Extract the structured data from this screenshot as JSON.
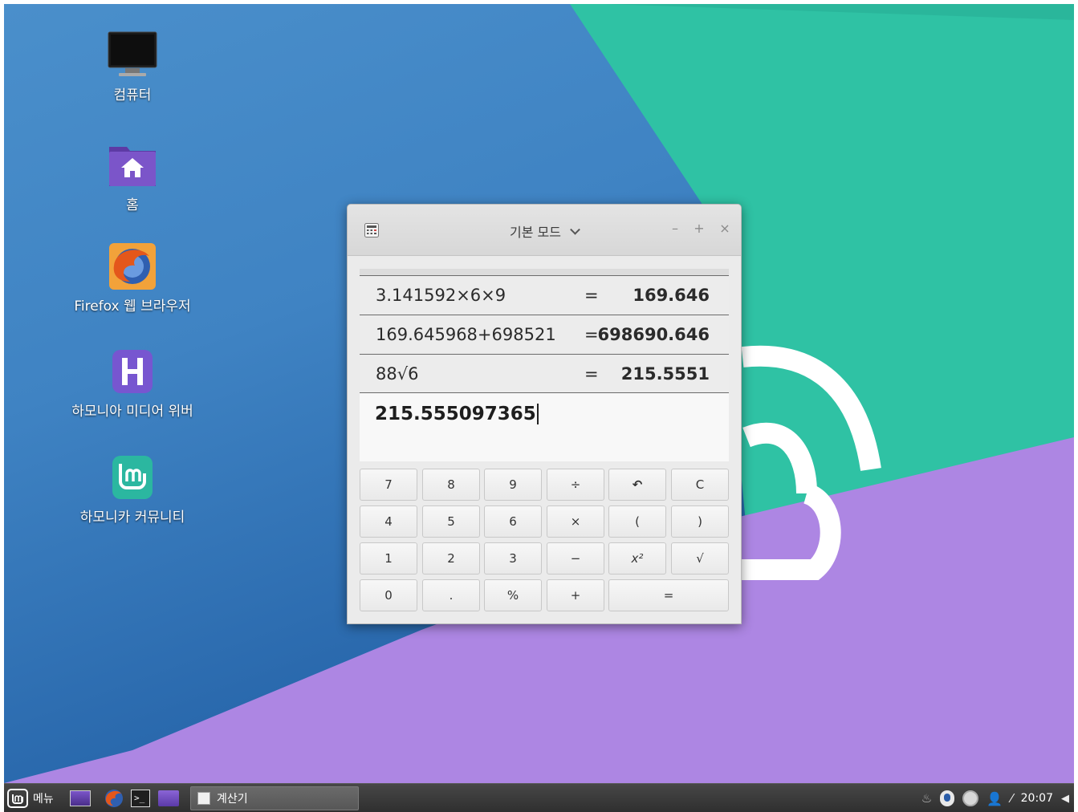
{
  "desktop": {
    "icons": [
      {
        "label": "컴퓨터",
        "icon": "computer-icon"
      },
      {
        "label": "홈",
        "icon": "home-folder-icon"
      },
      {
        "label": "Firefox 웹 브라우저",
        "icon": "firefox-icon"
      },
      {
        "label": "하모니아 미디어 위버",
        "icon": "media-player-icon"
      },
      {
        "label": "하모니카 커뮤니티",
        "icon": "community-icon"
      }
    ]
  },
  "calculator": {
    "mode_label": "기본 모드",
    "history": [
      {
        "expression": "3.141592×6×9",
        "equals": "=",
        "result": "169.646"
      },
      {
        "expression": "169.645968+698521",
        "equals": "=",
        "result": "698690.646"
      },
      {
        "expression": "88√6",
        "equals": "=",
        "result": "215.5551"
      }
    ],
    "display_value": "215.555097365",
    "keys": {
      "k7": "7",
      "k8": "8",
      "k9": "9",
      "divide": "÷",
      "undo": "↶",
      "clear": "C",
      "k4": "4",
      "k5": "5",
      "k6": "6",
      "multiply": "×",
      "lparen": "(",
      "rparen": ")",
      "k1": "1",
      "k2": "2",
      "k3": "3",
      "minus": "−",
      "square": "x²",
      "sqrt": "√",
      "k0": "0",
      "dot": ".",
      "percent": "%",
      "plus": "+",
      "equals": "="
    }
  },
  "taskbar": {
    "menu_label": "메뉴",
    "active_task": "계산기",
    "clock": "20:07"
  },
  "colors": {
    "wall_blue": "#3f83c3",
    "wall_green": "#2fc2a4",
    "wall_purple": "#ad86e3",
    "taskbar": "#383838"
  }
}
